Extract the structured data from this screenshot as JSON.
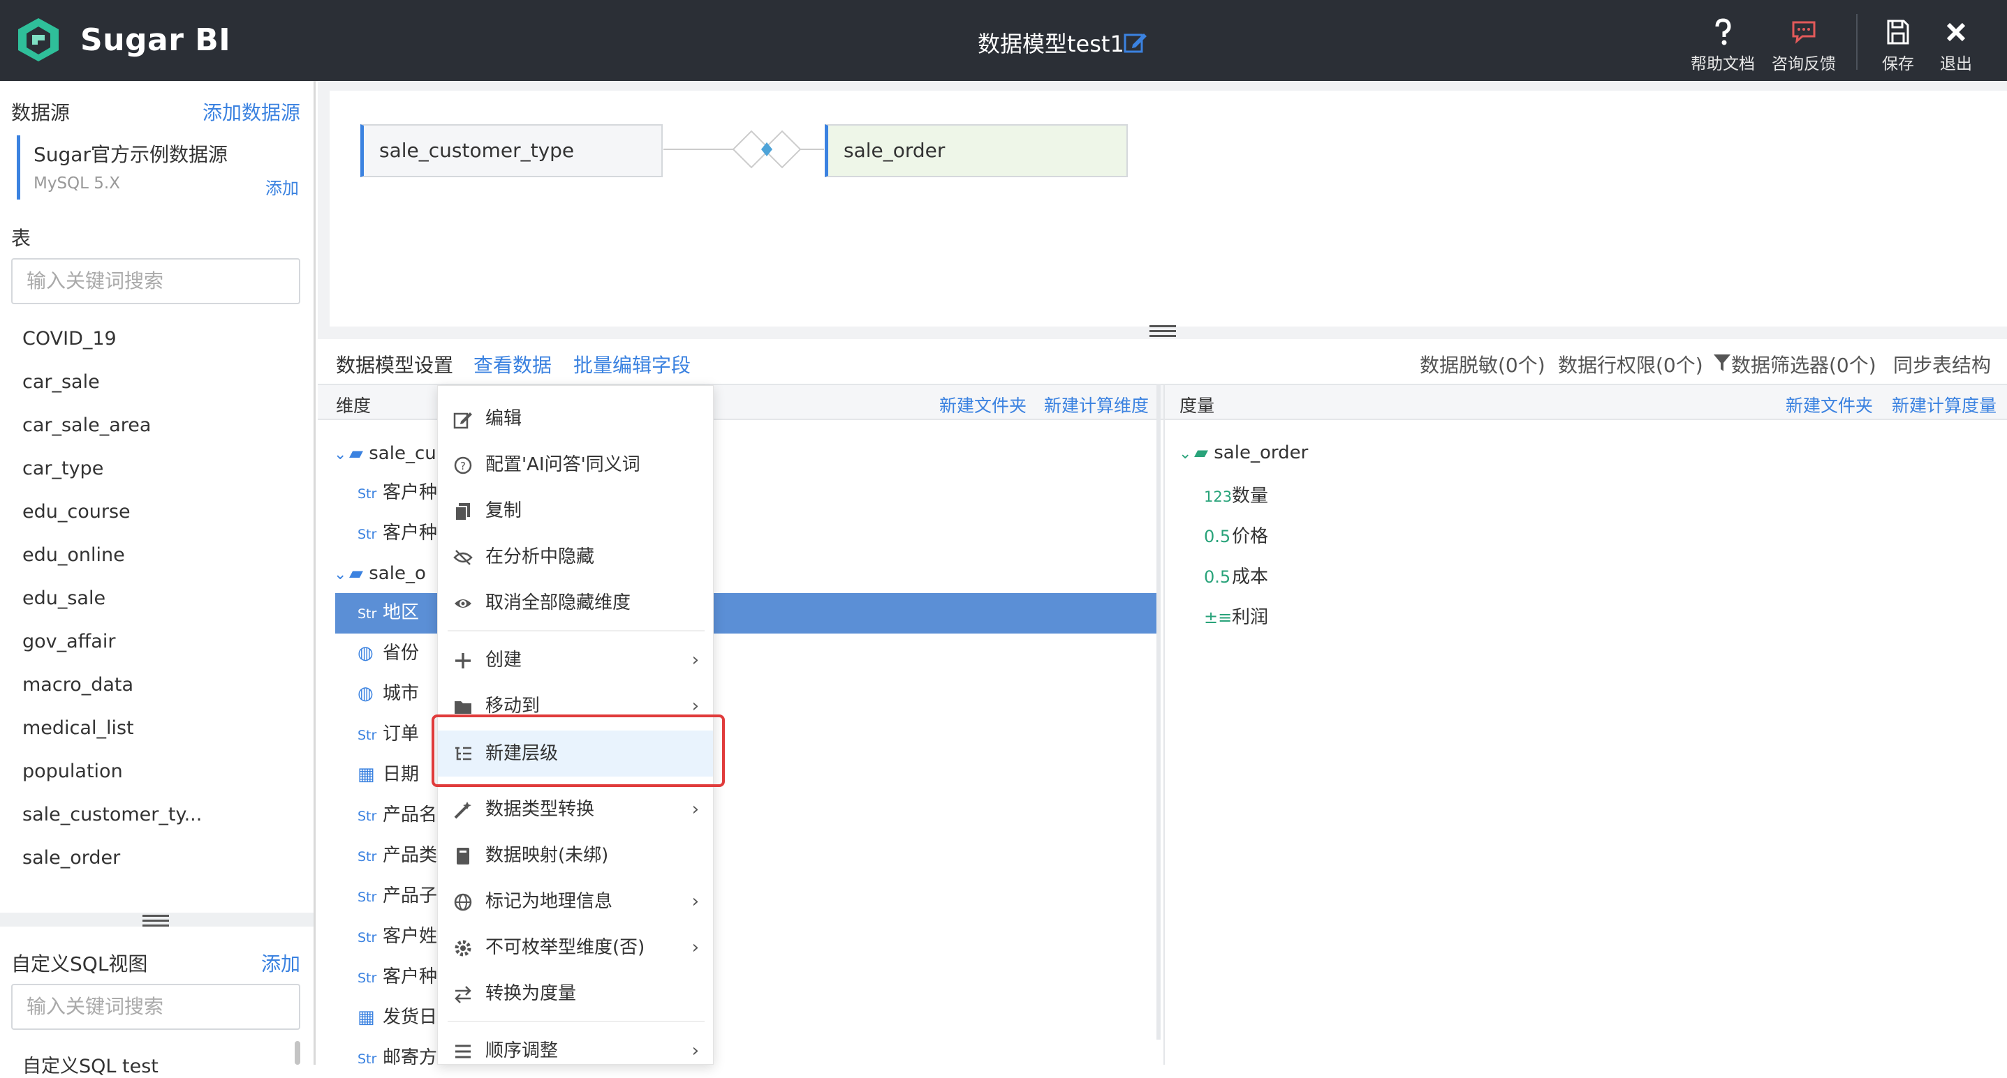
{
  "app": {
    "brand": "Sugar BI",
    "model_title": "数据模型test1"
  },
  "toolbar": {
    "help": "帮助文档",
    "feedback": "咨询反馈",
    "save": "保存",
    "exit": "退出"
  },
  "colors": {
    "accent": "#3b82e0",
    "topbar": "#2b2f36",
    "selected_row": "#5b8fd6",
    "highlight": "#e03b3b",
    "measure_green": "#29a37a"
  },
  "left": {
    "datasource_title": "数据源",
    "add_datasource": "添加数据源",
    "datasource_name": "Sugar官方示例数据源",
    "datasource_type": "MySQL 5.X",
    "datasource_add": "添加",
    "tables_title": "表",
    "search_placeholder": "输入关键词搜索",
    "tables": [
      "COVID_19",
      "car_sale",
      "car_sale_area",
      "car_type",
      "edu_course",
      "edu_online",
      "edu_sale",
      "gov_affair",
      "macro_data",
      "medical_list",
      "population",
      "sale_customer_ty...",
      "sale_order"
    ],
    "sql_title": "自定义SQL视图",
    "sql_add": "添加",
    "sql_search_placeholder": "输入关键词搜索",
    "sql_first_item": "自定义SQL test"
  },
  "canvas": {
    "left_table": "sale_customer_type",
    "right_table": "sale_order"
  },
  "tabs": {
    "settings": "数据模型设置",
    "view_data": "查看数据",
    "batch_edit": "批量编辑字段",
    "masking": "数据脱敏(0个)",
    "row_perm": "数据行权限(0个)",
    "filter": "数据筛选器(0个)",
    "sync": "同步表结构"
  },
  "dimensions": {
    "title": "维度",
    "new_folder": "新建文件夹",
    "new_calc": "新建计算维度",
    "folder1": "sale_cu",
    "folder2": "sale_o",
    "type_str": "Str",
    "rows": [
      "客户种",
      "客户种",
      "地区",
      "省份",
      "城市",
      "订单",
      "日期",
      "产品名",
      "产品类",
      "产品子",
      "客户姓",
      "客户种",
      "发货日",
      "邮寄方"
    ]
  },
  "measures": {
    "title": "度量",
    "new_folder": "新建文件夹",
    "new_calc": "新建计算度量",
    "folder": "sale_order",
    "items": [
      {
        "type": "123",
        "name": "数量"
      },
      {
        "type": "0.5",
        "name": "价格"
      },
      {
        "type": "0.5",
        "name": "成本"
      },
      {
        "type": "calc",
        "name": "利润"
      }
    ]
  },
  "context_menu": {
    "items": [
      {
        "label": "编辑",
        "icon": "edit-icon"
      },
      {
        "label": "配置'AI问答'同义词",
        "icon": "question-icon"
      },
      {
        "label": "复制",
        "icon": "copy-icon"
      },
      {
        "label": "在分析中隐藏",
        "icon": "eye-off-icon"
      },
      {
        "label": "取消全部隐藏维度",
        "icon": "eye-icon"
      },
      {
        "label": "创建",
        "icon": "plus-icon"
      },
      {
        "label": "移动到",
        "icon": "folder-icon"
      },
      {
        "label": "新建层级",
        "icon": "hierarchy-icon"
      },
      {
        "label": "数据类型转换",
        "icon": "wand-icon"
      },
      {
        "label": "数据映射(未绑)",
        "icon": "book-icon"
      },
      {
        "label": "标记为地理信息",
        "icon": "globe-icon"
      },
      {
        "label": "不可枚举型维度(否)",
        "icon": "gear-icon"
      },
      {
        "label": "转换为度量",
        "icon": "swap-icon"
      },
      {
        "label": "顺序调整",
        "icon": "list-icon"
      }
    ]
  }
}
